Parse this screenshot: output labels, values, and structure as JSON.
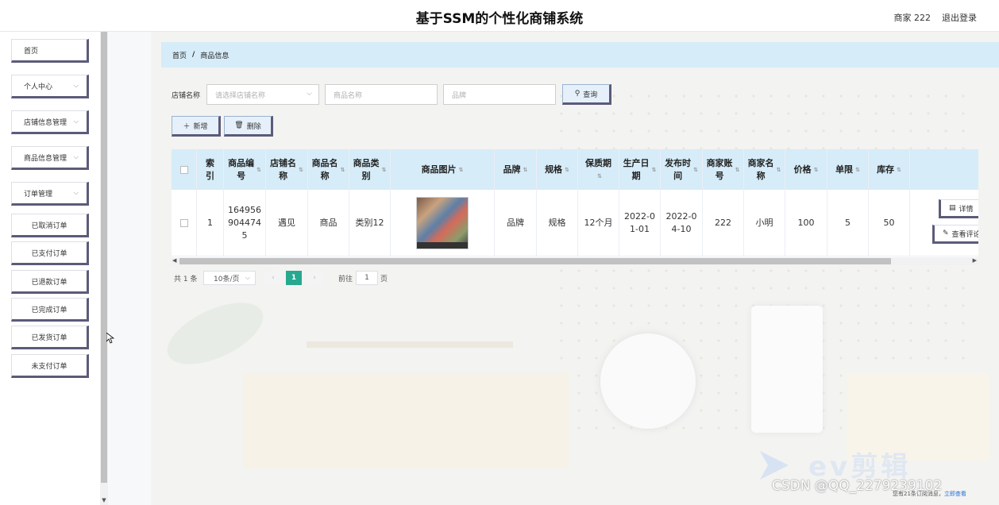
{
  "header": {
    "title": "基于SSM的个性化商铺系统",
    "user": "商家 222",
    "logout": "退出登录"
  },
  "sidebar": {
    "items": [
      {
        "label": "首页",
        "has_arrow": false
      },
      {
        "label": "个人中心",
        "has_arrow": true
      },
      {
        "label": "店铺信息管理",
        "has_arrow": true
      },
      {
        "label": "商品信息管理",
        "has_arrow": true
      },
      {
        "label": "订单管理",
        "has_arrow": true
      }
    ],
    "subitems": [
      "已取消订单",
      "已支付订单",
      "已退款订单",
      "已完成订单",
      "已发货订单",
      "未支付订单"
    ]
  },
  "breadcrumb": {
    "home": "首页",
    "separator": "/",
    "current": "商品信息"
  },
  "search": {
    "label": "店铺名称",
    "shop_placeholder": "请选择店铺名称",
    "name_placeholder": "商品名称",
    "brand_placeholder": "品牌",
    "query_label": "查询"
  },
  "toolbar": {
    "add_label": "新增",
    "delete_label": "删除"
  },
  "table": {
    "columns": [
      "索引",
      "商品编号",
      "店铺名称",
      "商品名称",
      "商品类别",
      "商品图片",
      "品牌",
      "规格",
      "保质期",
      "生产日期",
      "发布时间",
      "商家账号",
      "商家名称",
      "价格",
      "单限",
      "库存"
    ],
    "columns_display": [
      "索\n引",
      "商品编\n号",
      "店铺名\n称",
      "商品名\n称",
      "商品类\n别",
      "商品图片",
      "品牌",
      "规格",
      "保质期",
      "生产日\n期",
      "发布时\n间",
      "商家账\n号",
      "商家名\n称",
      "价格",
      "单限",
      "库存"
    ],
    "rows": [
      {
        "index": "1",
        "product_no": "164956\n904474\n5",
        "shop_name": "遇见",
        "product_name": "商品",
        "category": "类别12",
        "brand": "品牌",
        "spec": "规格",
        "shelf_life": "12个月",
        "production_date": "2022-0\n1-01",
        "publish_time": "2022-0\n4-10",
        "merchant_account": "222",
        "merchant_name": "小明",
        "price": "100",
        "limit": "5",
        "stock": "50"
      }
    ],
    "actions": {
      "detail": "详情",
      "review": "查看评论"
    }
  },
  "pagination": {
    "total": "共 1 条",
    "page_size": "10条/页",
    "current_page": "1",
    "goto_label": "前往",
    "goto_value": "1",
    "page_suffix": "页"
  },
  "watermark": {
    "brand": "ev剪辑",
    "csdn": "CSDN @QQ_2279239102"
  },
  "notice": {
    "text": "您有21条订阅消息，",
    "link": "立即查看"
  },
  "colors": {
    "accent": "#d6ecf8",
    "page_active": "#27a891",
    "button_shadow": "#5b5b7a"
  }
}
